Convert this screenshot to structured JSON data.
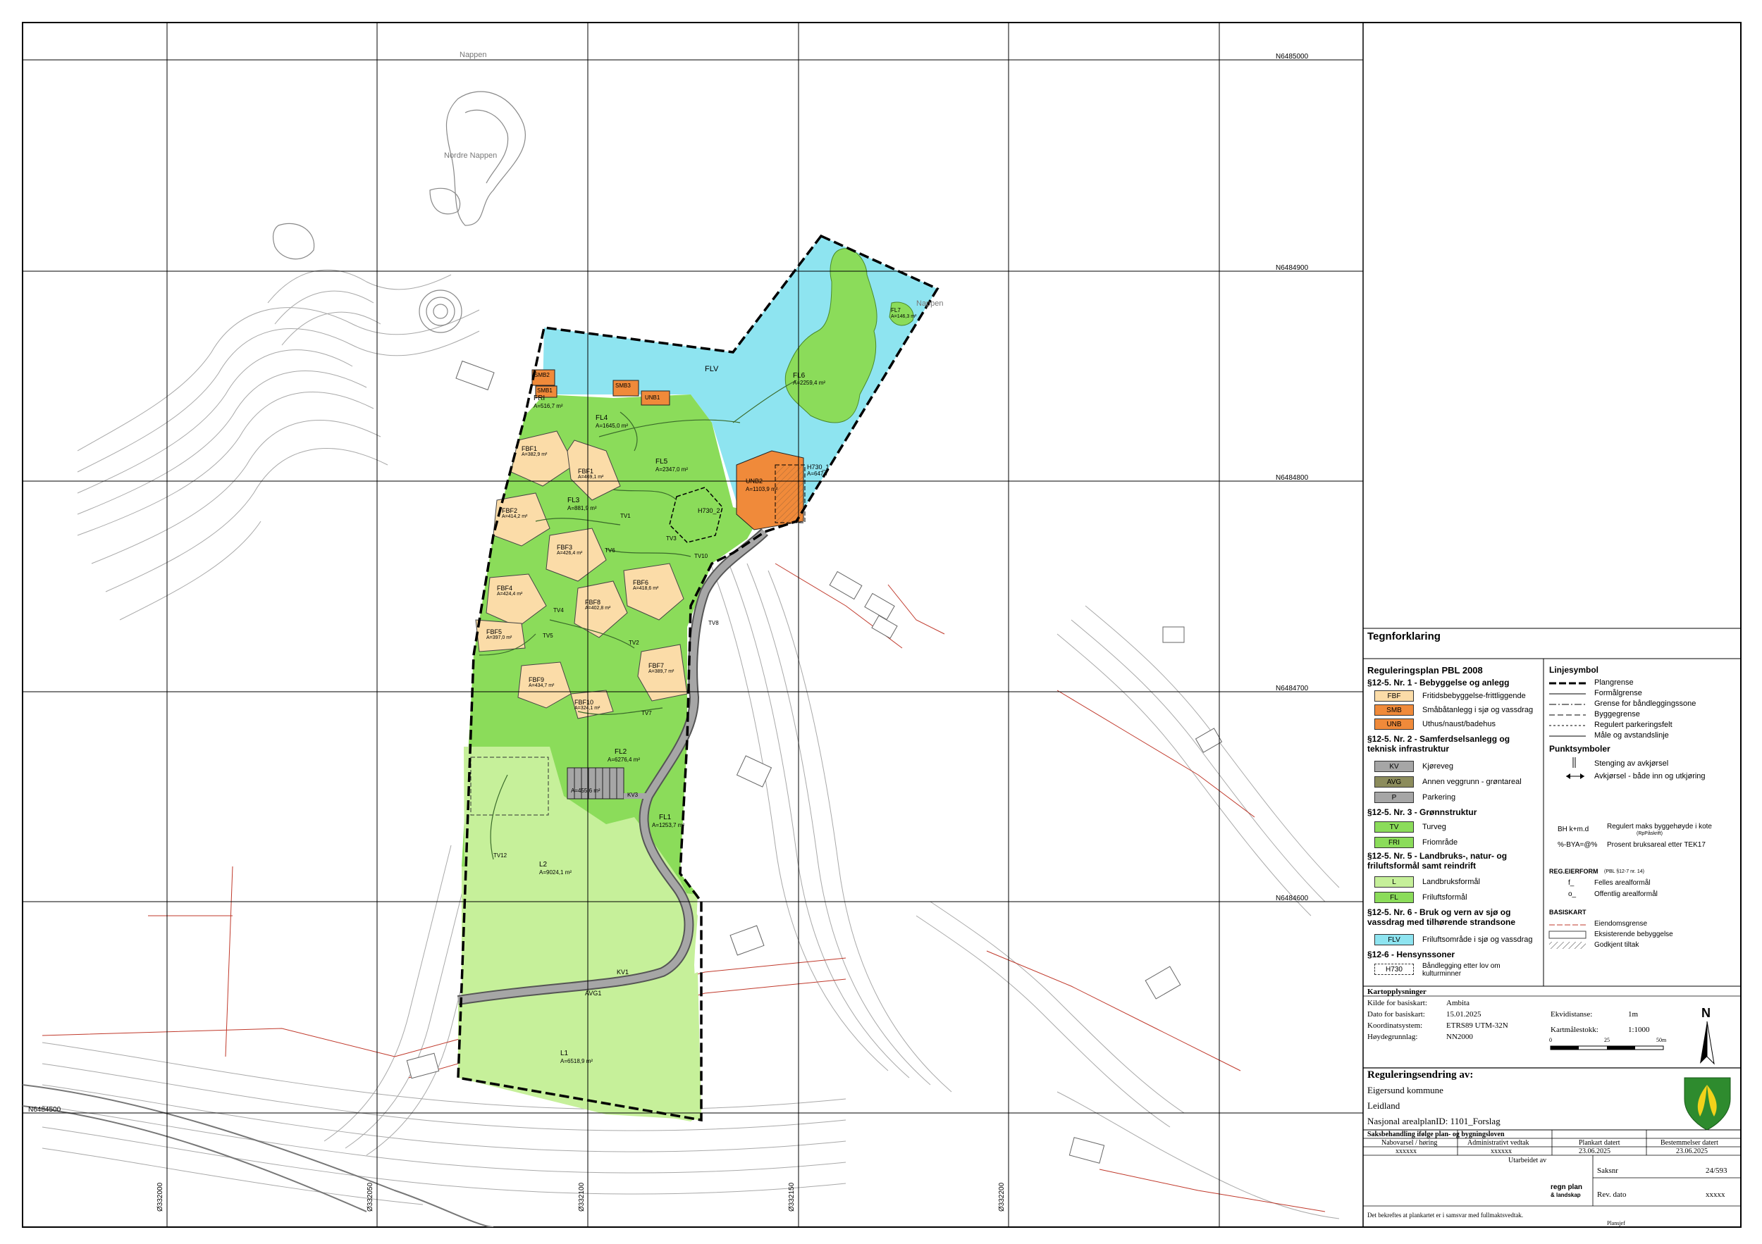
{
  "northings": [
    "N6485000",
    "N6484900",
    "N6484800",
    "N6484700",
    "N6484600",
    "N6484500"
  ],
  "eastings": [
    "Ø332000",
    "Ø332050",
    "Ø332100",
    "Ø332150",
    "Ø332200"
  ],
  "place_names": [
    "Nappen",
    "Nordre Nappen",
    "Nappen"
  ],
  "zones": {
    "FLV": {
      "code": "FLV",
      "area": ""
    },
    "FRI": {
      "code": "FRI",
      "area": "A=516,7 m²"
    },
    "FL4": {
      "code": "FL4",
      "area": "A=1645,0 m²"
    },
    "FL5": {
      "code": "FL5",
      "area": "A=2347,0 m²"
    },
    "FL6": {
      "code": "FL6",
      "area": "A=2259,4 m²"
    },
    "FL7": {
      "code": "FL7",
      "area": "A=146,3 m²"
    },
    "FL3": {
      "code": "FL3",
      "area": "A=881,9 m²"
    },
    "FL2": {
      "code": "FL2",
      "area": "A=6276,4 m²"
    },
    "FL1": {
      "code": "FL1",
      "area": "A=1253,7 m²"
    },
    "L2": {
      "code": "L2",
      "area": "A=9024,1 m²"
    },
    "L1": {
      "code": "L1",
      "area": "A=6518,9 m²"
    },
    "UNB2": {
      "code": "UNB2",
      "area": "A=1103,9 m²"
    },
    "H730_1": {
      "code": "H730_1",
      "area": "A=647,7"
    },
    "H730_2": {
      "code": "H730_2",
      "area": ""
    },
    "P": {
      "code": "",
      "area": "A=455,6 m²"
    },
    "SMB1": "SMB1",
    "SMB2": "SMB2",
    "SMB3": "SMB3",
    "UNB1": "UNB1",
    "FBF": [
      {
        "code": "FBF1",
        "area": "A=382,9 m²"
      },
      {
        "code": "FBF1",
        "area": "A=469,1 m²"
      },
      {
        "code": "FBF2",
        "area": "A=414,2 m²"
      },
      {
        "code": "FBF3",
        "area": "A=426,4 m²"
      },
      {
        "code": "FBF4",
        "area": "A=424,4 m²"
      },
      {
        "code": "FBF5",
        "area": "A=397,0 m²"
      },
      {
        "code": "FBF6",
        "area": "A=418,6 m²"
      },
      {
        "code": "FBF7",
        "area": "A=389,7 m²"
      },
      {
        "code": "FBF8",
        "area": "A=402,8 m²"
      },
      {
        "code": "FBF9",
        "area": "A=434,7 m²"
      },
      {
        "code": "FBF10",
        "area": "A=324,1 m²"
      }
    ],
    "TV": [
      "TV1",
      "TV2",
      "TV3",
      "TV4",
      "TV5",
      "TV6",
      "TV7",
      "TV8",
      "TV10",
      "TV12"
    ],
    "KV": [
      "KV1",
      "KV3"
    ],
    "AVG": [
      "AVG1"
    ]
  },
  "legend": {
    "title": "Tegnforklaring",
    "plan_heading": "Reguleringsplan PBL 2008",
    "s1": "§12-5. Nr. 1 - Bebyggelse og anlegg",
    "s2": "§12-5. Nr. 2 - Samferdselsanlegg og teknisk infrastruktur",
    "s3": "§12-5. Nr. 3 - Grønnstruktur",
    "s5": "§12-5. Nr. 5 - Landbruks-, natur- og friluftsformål samt reindrift",
    "s6": "§12-5. Nr. 6 - Bruk og vern av sjø og vassdrag med tilhørende strandsone",
    "s7": "§12-6 - Hensynssoner",
    "items": [
      {
        "code": "FBF",
        "label": "Fritidsbebyggelse-frittliggende",
        "color": "#fbdca8"
      },
      {
        "code": "SMB",
        "label": "Småbåtanlegg i sjø og vassdrag",
        "color": "#f08a3a"
      },
      {
        "code": "UNB",
        "label": "Uthus/naust/badehus",
        "color": "#f08a3a"
      },
      {
        "code": "KV",
        "label": "Kjøreveg",
        "color": "#a6a6a6"
      },
      {
        "code": "AVG",
        "label": "Annen veggrunn - grøntareal",
        "color": "#8c8c5c"
      },
      {
        "code": "P",
        "label": "Parkering",
        "color": "#a6a6a6"
      },
      {
        "code": "TV",
        "label": "Turveg",
        "color": "#8bdc5a"
      },
      {
        "code": "FRI",
        "label": "Friområde",
        "color": "#8bdc5a"
      },
      {
        "code": "L",
        "label": "Landbruksformål",
        "color": "#c6f09a"
      },
      {
        "code": "FL",
        "label": "Friluftsformål",
        "color": "#8bdc5a"
      },
      {
        "code": "FLV",
        "label": "Friluftsområde i sjø og vassdrag",
        "color": "#8ee4f0"
      },
      {
        "code": "H730",
        "label": "Båndlegging etter lov om kulturminner",
        "color": "#ffffff"
      }
    ],
    "line_heading": "Linjesymbol",
    "lines": [
      "Plangrense",
      "Formålgrense",
      "Grense for båndleggingssone",
      "Byggegrense",
      "Regulert parkeringsfelt",
      "Måle og avstandslinje"
    ],
    "point_heading": "Punktsymboler",
    "points": [
      "Stenging av avkjørsel",
      "Avkjørsel - både inn og utkjøring"
    ],
    "bh_code": "BH k+m.d",
    "bh_label": "Regulert maks byggehøyde i kote",
    "bh_sub": "(RpPåskrift)",
    "bya_code": "%-BYA=@%",
    "bya_label": "Prosent bruksareal etter TEK17",
    "eier_heading": "REG.EIERFORM",
    "eier_sub": "(PBL §12-7 nr. 14)",
    "eier_f_code": "f_",
    "eier_f": "Felles arealformål",
    "eier_o_code": "o_",
    "eier_o": "Offentlig arealformål",
    "basis_heading": "BASISKART",
    "basis": [
      "Eiendomsgrense",
      "Eksisterende bebyggelse",
      "Godkjent tiltak"
    ]
  },
  "title_block": {
    "kart_heading": "Kartopplysninger",
    "kilde_label": "Kilde for basiskart:",
    "kilde": "Ambita",
    "dato_label": "Dato for basiskart:",
    "dato": "15.01.2025",
    "koord_label": "Koordinatsystem:",
    "koord": "ETRS89 UTM-32N",
    "hoyde_label": "Høydegrunnlag:",
    "hoyde": "NN2000",
    "ekvi_label": "Ekvidistanse:",
    "ekvi": "1m",
    "maal_label": "Kartmålestokk:",
    "maal": "1:1000",
    "scale_ticks": [
      "0",
      "25",
      "50m"
    ],
    "north": "N",
    "regulering_heading": "Reguleringsendring av:",
    "kommune": "Eigersund kommune",
    "sted": "Leidland",
    "arealplan": "Nasjonal arealplanID:  1101_Forslag",
    "saks_heading": "Saksbehandling ifølge plan- og bygningsloven",
    "col_headers": [
      "Nabovarsel / høring",
      "Administrativt vedtak",
      "Plankart datert",
      "Bestemmelser datert"
    ],
    "col_values": [
      "xxxxxx",
      "xxxxxx",
      "23.06.2025",
      "23.06.2025"
    ],
    "utarbeidet": "Utarbeidet av",
    "firm": "regn plan",
    "firm_sub": "& landskap",
    "saksnr_label": "Saksnr",
    "saksnr": "24/593",
    "rev_label": "Rev. dato",
    "rev": "xxxxx",
    "footer": "Det bekreftes at plankartet er i samsvar med fullmaktsvedtak.",
    "plansjef": "Plansjef"
  },
  "colors": {
    "fl": "#8bdc5a",
    "l": "#c6f09a",
    "flv": "#8ee4f0",
    "fbf": "#fbdca8",
    "smb": "#f08a3a",
    "road": "#9a9a9a",
    "contour": "#9a9a9a",
    "property": "#c0392b",
    "grid": "#000000"
  }
}
